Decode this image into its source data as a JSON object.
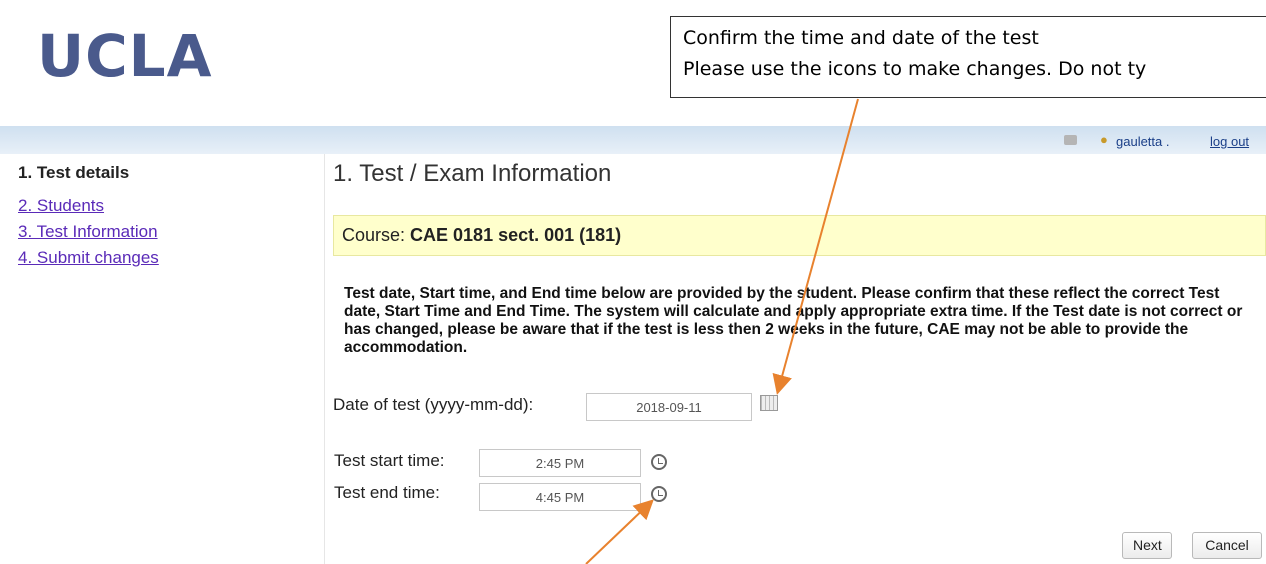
{
  "logo": "UCLA",
  "callout": {
    "line1": "Confirm the time and date of the test",
    "line2": "Please use the icons to make changes. Do not ty"
  },
  "topbar": {
    "user": "gauletta",
    "separator": ".",
    "logout": "log out"
  },
  "sidebar": {
    "items": [
      {
        "label": "1. Test details",
        "active": true
      },
      {
        "label": "2. Students",
        "active": false
      },
      {
        "label": "3. Test Information",
        "active": false
      },
      {
        "label": "4. Submit changes",
        "active": false
      }
    ]
  },
  "main": {
    "title": "1. Test / Exam Information",
    "course_prefix": "Course: ",
    "course_name": "CAE 0181 sect. 001 (181)",
    "notice": "Test date, Start time, and End time below are provided by the student. Please confirm that these reflect the correct Test date, Start Time and End Time. The system will calculate and apply appropriate extra time. If the Test date is not correct or has changed, please be aware that if the test is less then 2 weeks in the future, CAE may not be able to provide the accommodation.",
    "date_label": "Date of test (yyyy-mm-dd):",
    "date_value": "2018-09-11",
    "start_label": "Test start time:",
    "start_value": "2:45 PM",
    "end_label": "Test end time:",
    "end_value": "4:45 PM",
    "next_button": "Next",
    "cancel_button": "Cancel"
  },
  "icons": {
    "printer": "printer-icon",
    "user": "user-icon",
    "calendar": "calendar-icon",
    "clock": "alarm-clock-icon"
  },
  "colors": {
    "logo": "#4a5a8c",
    "course_bar": "#ffffcc",
    "arrow": "#e8822e",
    "link": "#5a2ab8"
  }
}
